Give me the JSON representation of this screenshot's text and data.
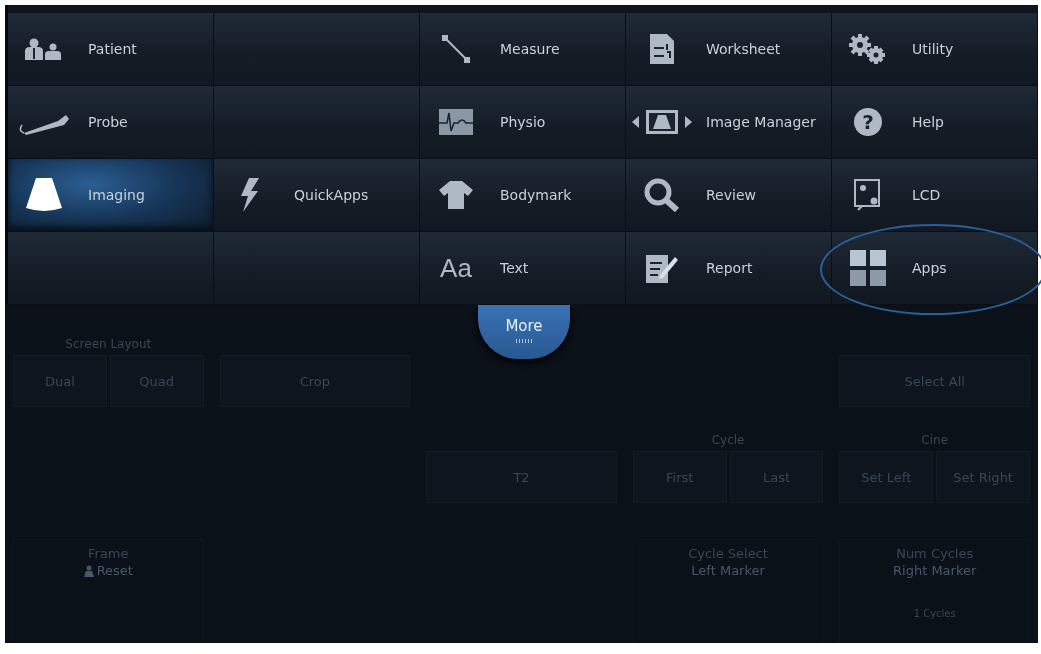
{
  "menu_tiles": [
    {
      "kind": "button",
      "label": "Patient",
      "selected": false,
      "circled": false
    },
    {
      "kind": "empty",
      "selected": false
    },
    {
      "kind": "button",
      "label": "Measure",
      "selected": false,
      "circled": false
    },
    {
      "kind": "button",
      "label": "Worksheet",
      "selected": false,
      "circled": false
    },
    {
      "kind": "button",
      "label": "Utility",
      "selected": false,
      "circled": false
    },
    {
      "kind": "button",
      "label": "Probe",
      "selected": false,
      "circled": false
    },
    {
      "kind": "empty",
      "selected": false
    },
    {
      "kind": "button",
      "label": "Physio",
      "selected": false,
      "circled": false
    },
    {
      "kind": "button",
      "label": "Image Manager",
      "selected": false,
      "circled": false
    },
    {
      "kind": "button",
      "icon_glyph": "?",
      "label": "Help",
      "selected": false,
      "circled": false
    },
    {
      "kind": "button",
      "label": "Imaging",
      "selected": true,
      "circled": false
    },
    {
      "kind": "button",
      "label": "QuickApps",
      "selected": false,
      "circled": false
    },
    {
      "kind": "button",
      "label": "Bodymark",
      "selected": false,
      "circled": false
    },
    {
      "kind": "button",
      "label": "Review",
      "selected": false,
      "circled": false
    },
    {
      "kind": "button",
      "label": "LCD",
      "selected": false,
      "circled": false
    },
    {
      "kind": "empty",
      "selected": false
    },
    {
      "kind": "empty",
      "selected": false
    },
    {
      "kind": "button",
      "icon_glyph": "Aa",
      "label": "Text",
      "selected": false,
      "circled": false
    },
    {
      "kind": "button",
      "label": "Report",
      "selected": false,
      "circled": false
    },
    {
      "kind": "button",
      "label": "Apps",
      "selected": false,
      "circled": true
    }
  ],
  "more_tab": {
    "label": "More"
  },
  "dimmed_panel": {
    "rows": [
      [
        {
          "kind": "group",
          "label": "Screen Layout",
          "buttons": [
            "Dual",
            "Quad"
          ]
        },
        {
          "kind": "button",
          "label": "Crop"
        },
        {
          "kind": "empty"
        },
        {
          "kind": "empty"
        },
        {
          "kind": "button",
          "label": "Select All"
        }
      ],
      [
        {
          "kind": "empty"
        },
        {
          "kind": "empty"
        },
        {
          "kind": "button",
          "label": "T2"
        },
        {
          "kind": "group",
          "label": "Cycle",
          "buttons": [
            "First",
            "Last"
          ]
        },
        {
          "kind": "group",
          "label": "Cine",
          "buttons": [
            "Set Left",
            "Set Right"
          ]
        }
      ],
      [
        {
          "kind": "knob",
          "title": "Frame",
          "subtitle": "Reset"
        },
        {
          "kind": "empty"
        },
        {
          "kind": "empty"
        },
        {
          "kind": "knob",
          "title": "Cycle Select",
          "subtitle": "Left Marker"
        },
        {
          "kind": "knob",
          "title": "Num Cycles",
          "subtitle": "Right Marker",
          "reading": "1 Cycles"
        }
      ]
    ]
  }
}
